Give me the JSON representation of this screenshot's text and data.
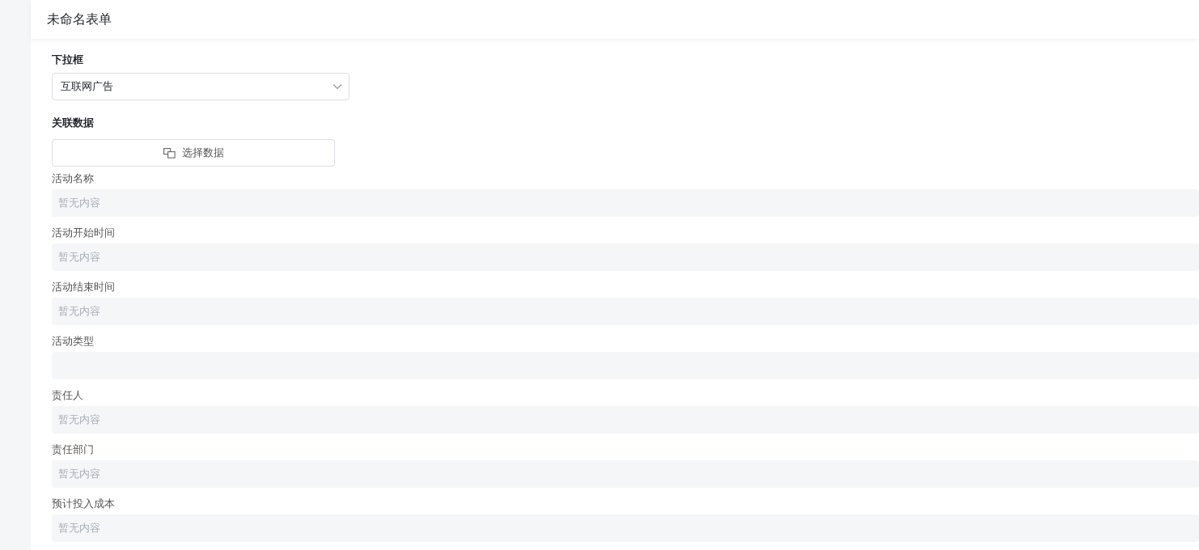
{
  "header": {
    "title": "未命名表单"
  },
  "select": {
    "label": "下拉框",
    "value": "互联网广告"
  },
  "relation": {
    "label": "关联数据",
    "button": "选择数据"
  },
  "fields": [
    {
      "label": "活动名称",
      "placeholder": "暂无内容"
    },
    {
      "label": "活动开始时间",
      "placeholder": "暂无内容"
    },
    {
      "label": "活动结束时间",
      "placeholder": "暂无内容"
    },
    {
      "label": "活动类型"
    },
    {
      "label": "责任人",
      "placeholder": "暂无内容"
    },
    {
      "label": "责任部门",
      "placeholder": "暂无内容"
    },
    {
      "label": "预计投入成本",
      "placeholder": "暂无内容"
    }
  ]
}
